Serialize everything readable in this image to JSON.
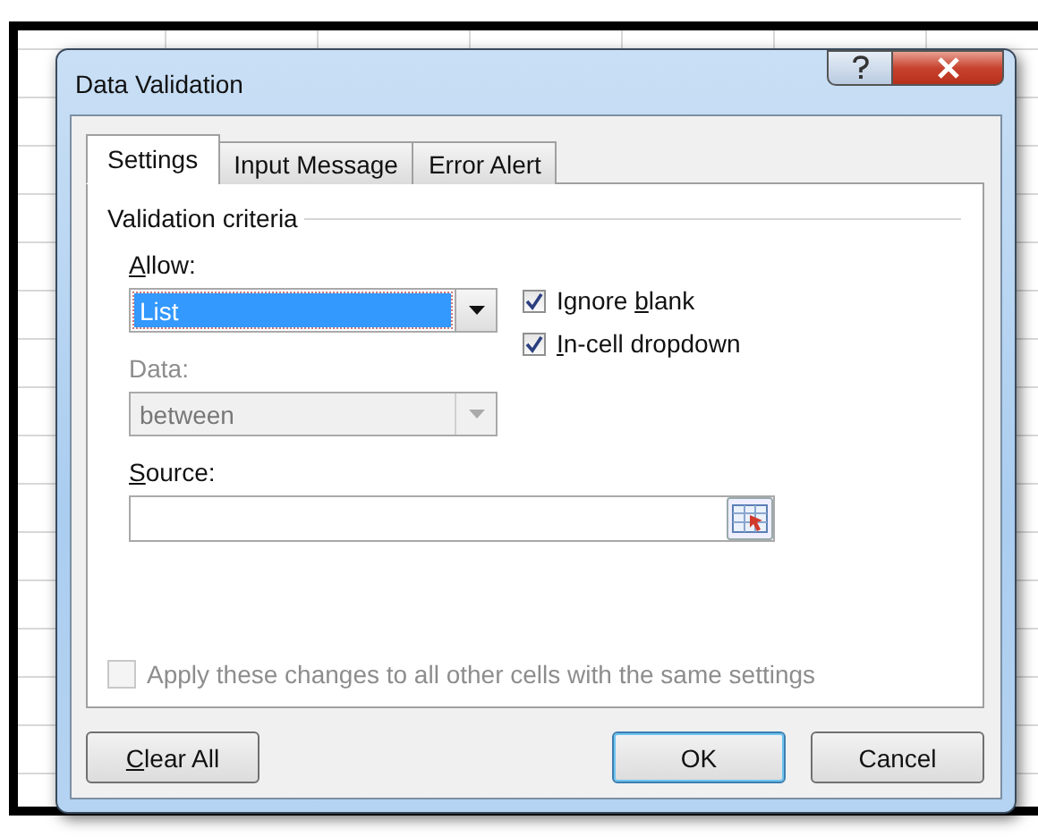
{
  "window": {
    "title": "Data Validation"
  },
  "tabs": [
    {
      "label": "Settings",
      "selected": true
    },
    {
      "label": "Input Message",
      "selected": false
    },
    {
      "label": "Error Alert",
      "selected": false
    }
  ],
  "criteria": {
    "heading": "Validation criteria",
    "allow": {
      "label": "Allow:",
      "value": "List"
    },
    "data": {
      "label": "Data:",
      "value": "between",
      "disabled": true
    },
    "options": [
      {
        "label": "Ignore blank",
        "checked": true
      },
      {
        "label": "In-cell dropdown",
        "checked": true
      }
    ],
    "source": {
      "label": "Source:"
    }
  },
  "apply_all": {
    "label": "Apply these changes to all other cells with the same settings",
    "checked": false,
    "disabled": true
  },
  "buttons": [
    {
      "label": "Clear All",
      "default": false
    },
    {
      "label": "OK",
      "default": true
    },
    {
      "label": "Cancel",
      "default": false
    }
  ]
}
